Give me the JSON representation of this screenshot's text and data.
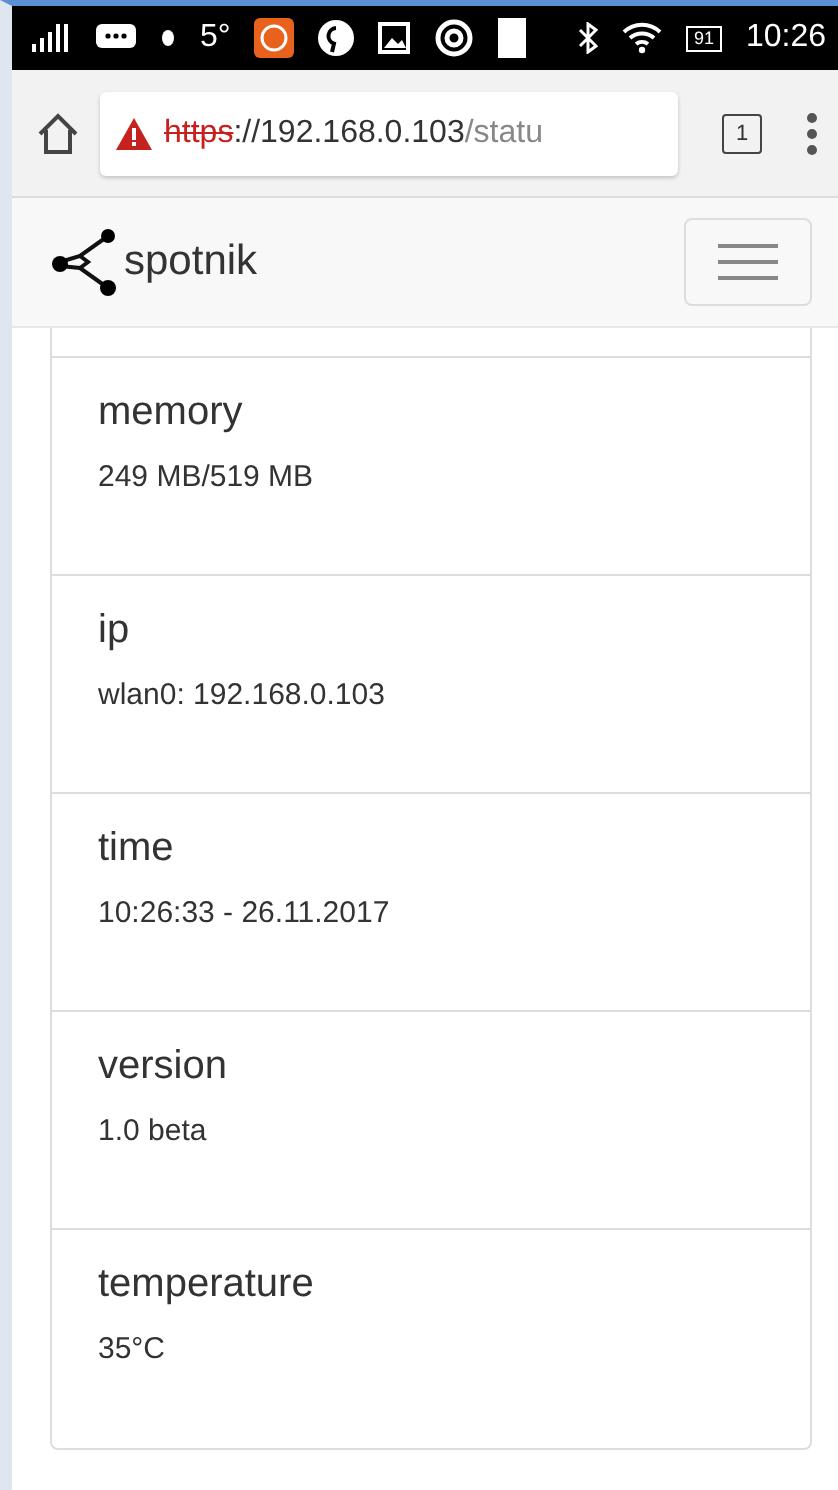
{
  "status_bar": {
    "temperature": "5°",
    "battery": "91",
    "time": "10:26"
  },
  "browser": {
    "url_scheme": "https",
    "url_host": "://192.168.0.103",
    "url_path": "/statu",
    "tab_count": "1"
  },
  "navbar": {
    "brand": "spotnik"
  },
  "status_items": [
    {
      "label": "memory",
      "value": "249 MB/519 MB"
    },
    {
      "label": "ip",
      "value": "wlan0: 192.168.0.103"
    },
    {
      "label": "time",
      "value": "10:26:33 - 26.11.2017"
    },
    {
      "label": "version",
      "value": "1.0 beta"
    },
    {
      "label": "temperature",
      "value": "35°C"
    }
  ]
}
